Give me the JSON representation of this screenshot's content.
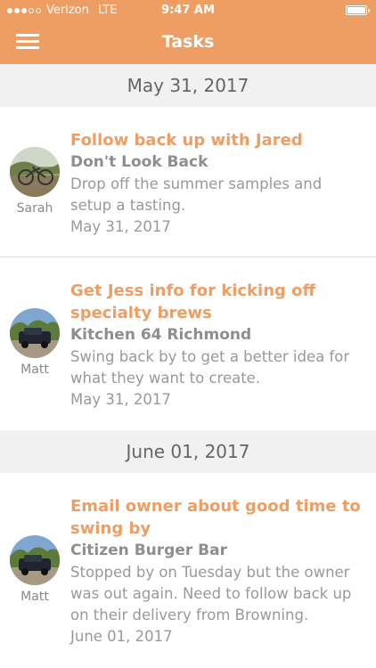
{
  "status_bar": {
    "carrier": "Verizon",
    "network": "LTE",
    "time": "9:47 AM",
    "signal_bars": 3,
    "signal_max": 5,
    "battery_level": 1.0
  },
  "nav": {
    "title": "Tasks",
    "menu_icon": "hamburger-menu-icon"
  },
  "colors": {
    "accent": "#ef9e63",
    "background": "#f1f1f1",
    "card": "#ffffff",
    "secondary_text": "#999999"
  },
  "sections": [
    {
      "date": "May 31, 2017",
      "tasks": [
        {
          "title": "Follow back up with Jared",
          "account": "Don't Look Back",
          "note": "Drop off the summer samples and setup a tasting.",
          "date": "May 31, 2017",
          "assignee": "Sarah",
          "avatar_icon": "bicycle-photo-avatar"
        },
        {
          "title": "Get Jess info for kicking off specialty brews",
          "account": "Kitchen 64 Richmond",
          "note": "Swing back by to get a better idea for what they want to create.",
          "date": "May 31, 2017",
          "assignee": "Matt",
          "avatar_icon": "truck-photo-avatar"
        }
      ]
    },
    {
      "date": "June 01, 2017",
      "tasks": [
        {
          "title": "Email owner about good time to swing by",
          "account": "Citizen Burger Bar",
          "note": "Stopped by on Tuesday but the owner was out again. Need to follow back up on their delivery from Browning.",
          "date": "June 01, 2017",
          "assignee": "Matt",
          "avatar_icon": "truck-photo-avatar"
        }
      ]
    }
  ]
}
